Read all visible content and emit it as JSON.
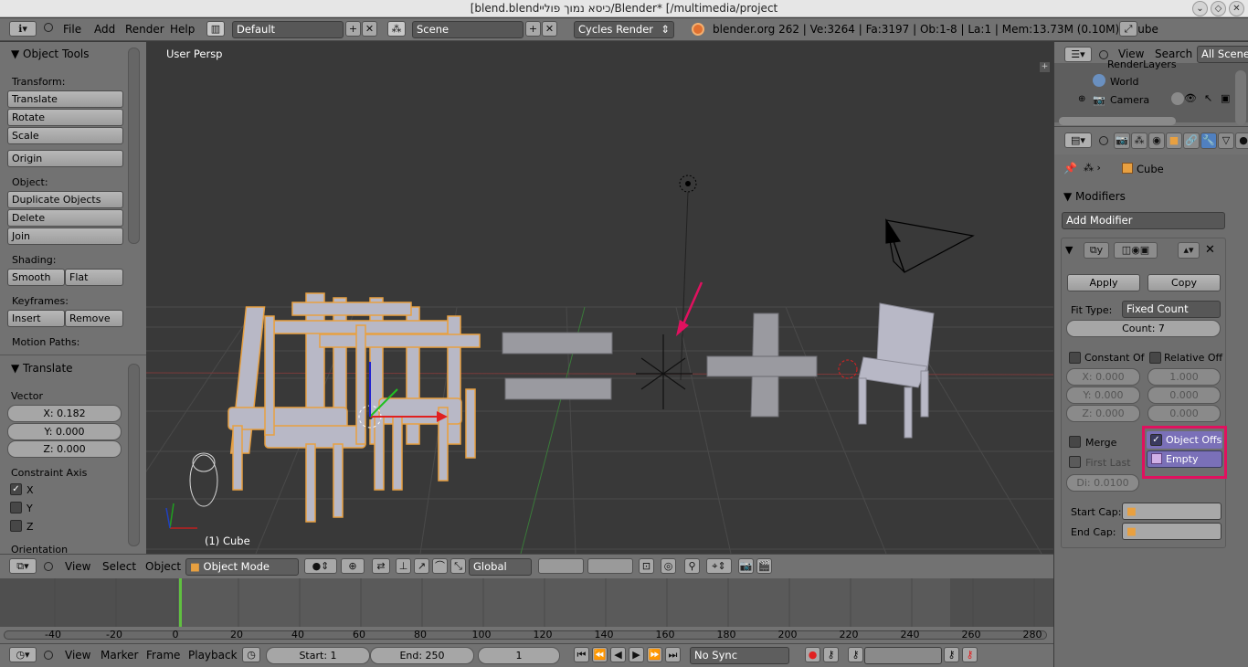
{
  "titlebar": {
    "title": "[blend.blendכיסא נמוך פוליי/Blender* [/multimedia/project"
  },
  "infobar": {
    "menus": [
      "File",
      "Add",
      "Render",
      "Help"
    ],
    "layout": "Default",
    "scene": "Scene",
    "engine": "Cycles Render",
    "stats": "blender.org 262 | Ve:3264 | Fa:3197 | Ob:1-8 | La:1 | Mem:13.73M (0.10M) | Cube"
  },
  "tool_panel": {
    "header": "Object Tools",
    "transform_label": "Transform:",
    "translate": "Translate",
    "rotate": "Rotate",
    "scale": "Scale",
    "origin": "Origin",
    "object_label": "Object:",
    "duplicate": "Duplicate Objects",
    "delete": "Delete",
    "join": "Join",
    "shading_label": "Shading:",
    "smooth": "Smooth",
    "flat": "Flat",
    "keyframes_label": "Keyframes:",
    "insert": "Insert",
    "remove": "Remove",
    "motion_label": "Motion Paths:"
  },
  "operator_panel": {
    "header": "Translate",
    "vector_label": "Vector",
    "x": "X: 0.182",
    "y": "Y: 0.000",
    "z": "Z: 0.000",
    "constraint_label": "Constraint Axis",
    "cx": "X",
    "cy": "Y",
    "cz": "Z",
    "orientation_label": "Orientation"
  },
  "viewport": {
    "view_name": "User Persp",
    "object_label": "(1) Cube"
  },
  "view_header": {
    "menus": [
      "View",
      "Select",
      "Object"
    ],
    "mode": "Object Mode",
    "orientation": "Global"
  },
  "timeline": {
    "ticks": [
      "-40",
      "-20",
      "0",
      "20",
      "40",
      "60",
      "80",
      "100",
      "120",
      "140",
      "160",
      "180",
      "200",
      "220",
      "240",
      "260",
      "280"
    ],
    "current_frame_fraction": 0.1435
  },
  "timeline_footer": {
    "menus": [
      "View",
      "Marker",
      "Frame",
      "Playback"
    ],
    "start": "Start: 1",
    "end": "End: 250",
    "current": "1",
    "sync": "No Sync"
  },
  "outliner": {
    "menus": [
      "View",
      "Search"
    ],
    "filter": "All Scenes",
    "items": [
      "RenderLayers",
      "World",
      "Camera"
    ]
  },
  "properties": {
    "breadcrumb": "Cube",
    "modifiers_header": "Modifiers",
    "add_modifier": "Add Modifier",
    "apply": "Apply",
    "copy": "Copy",
    "fit_type_label": "Fit Type:",
    "fit_type": "Fixed Count",
    "count": "Count: 7",
    "constant_label": "Constant Of",
    "relative_label": "Relative Off",
    "const_x": "X: 0.000",
    "const_y": "Y: 0.000",
    "const_z": "Z: 0.000",
    "rel_x": "1.000",
    "rel_y": "0.000",
    "rel_z": "0.000",
    "merge_label": "Merge",
    "first_last_label": "First Last",
    "distance": "Di: 0.0100",
    "object_offset_label": "Object Offs",
    "object_offset_value": "Empty",
    "start_cap_label": "Start Cap:",
    "end_cap_label": "End Cap:"
  },
  "colors": {
    "highlight": "#e0115f",
    "selected_outline": "#f0a030",
    "frame_marker": "#60c040"
  }
}
